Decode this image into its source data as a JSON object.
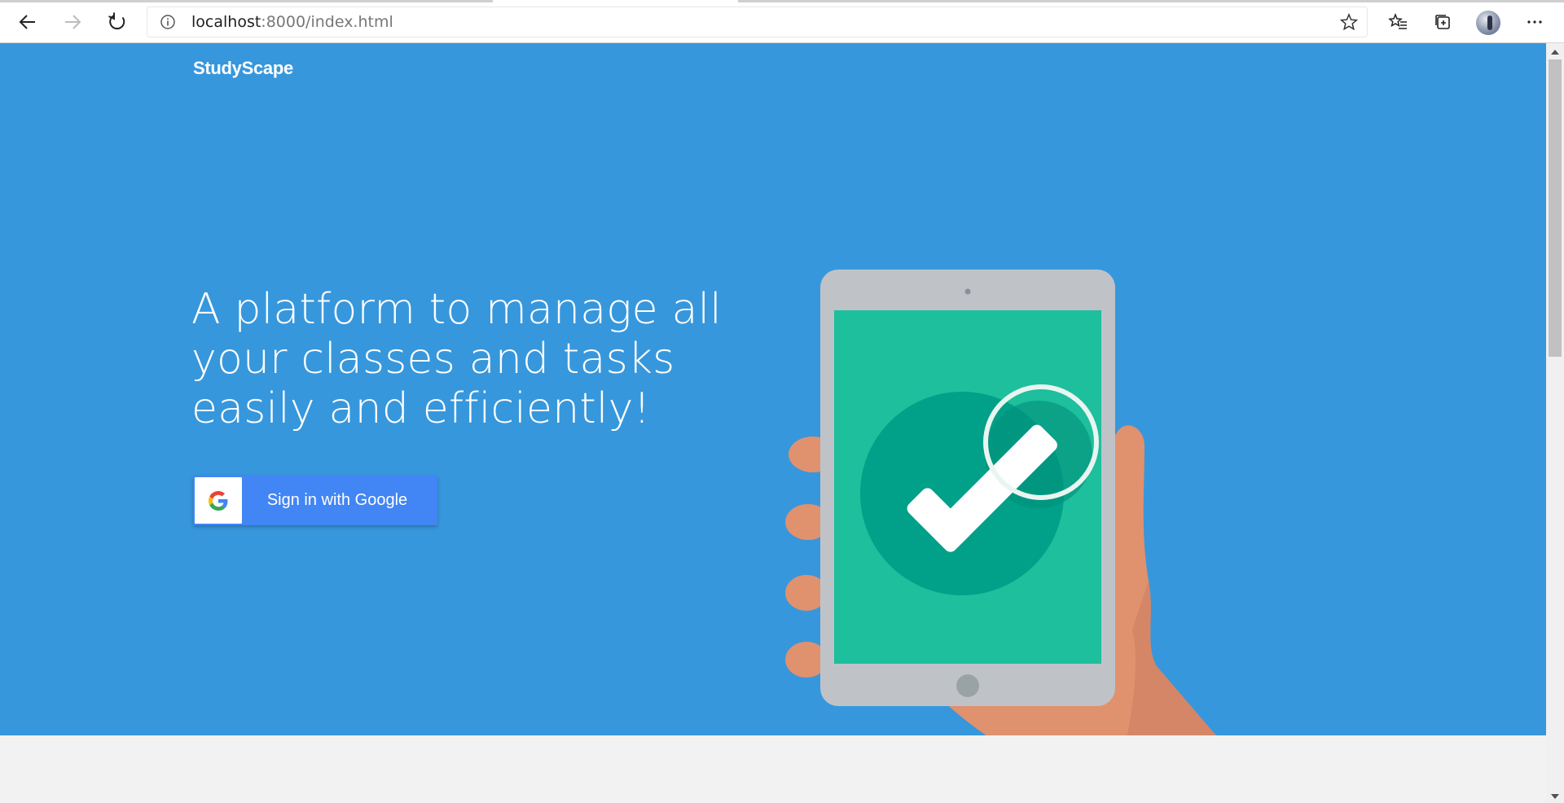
{
  "browser": {
    "url_host": "localhost",
    "url_path": ":8000/index.html",
    "icons": [
      "back-icon",
      "forward-icon",
      "refresh-icon",
      "info-icon",
      "star-icon",
      "favorites-icon",
      "collections-icon",
      "profile-avatar",
      "more-icon"
    ]
  },
  "page": {
    "brand": "StudyScape",
    "headline_lines": [
      "A platform to manage all",
      "your classes and tasks",
      "easily and efficiently!"
    ],
    "signin_label": "Sign in with Google",
    "colors": {
      "hero_bg": "#3797dc",
      "button_bg": "#4285f4",
      "tablet_frame": "#bfc3c8",
      "tablet_screen": "#1dbf9d",
      "check_circle": "#00a089",
      "skin": "#e0916e"
    }
  }
}
